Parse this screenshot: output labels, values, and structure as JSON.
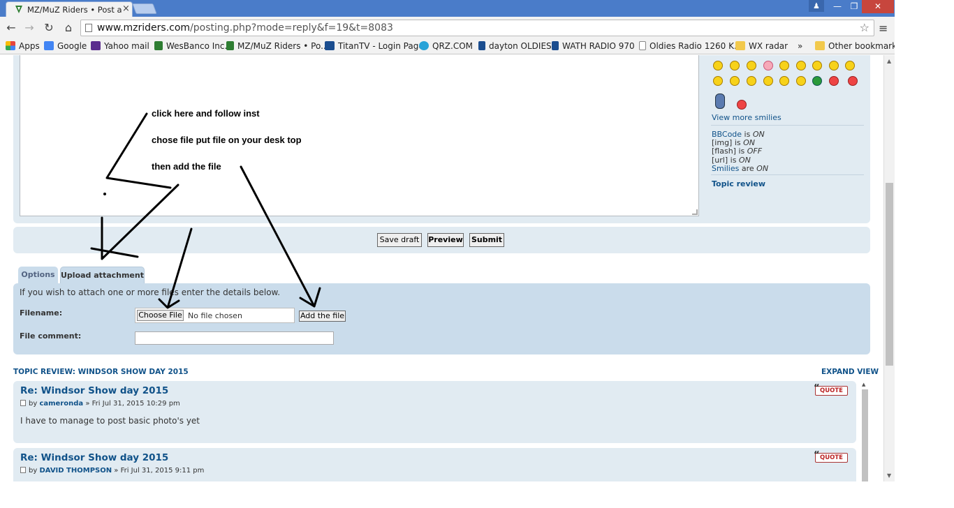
{
  "browser": {
    "tab_title": "MZ/MuZ Riders • Post a re",
    "tab_close": "×",
    "window_controls": {
      "user": "♟",
      "minimize": "—",
      "maximize": "❐",
      "close": "✕"
    },
    "nav": {
      "back": "←",
      "forward": "→",
      "reload": "↻",
      "home": "⌂"
    },
    "url_host": "www.mzriders.com",
    "url_path": "/posting.php?mode=reply&f=19&t=8083",
    "star": "☆",
    "menu": "≡"
  },
  "bookmarks": {
    "items": [
      {
        "label": "Apps",
        "icon": "apps-icon",
        "color": "#e8453c"
      },
      {
        "label": "Google",
        "icon": "google-icon",
        "color": "#4285f4"
      },
      {
        "label": "Yahoo mail",
        "icon": "yahoo-icon",
        "color": "#5b2d8e"
      },
      {
        "label": "WesBanco Inc.",
        "icon": "wesbanco-icon",
        "color": "#2e7d32"
      },
      {
        "label": "MZ/MuZ Riders • Po...",
        "icon": "mz-icon",
        "color": "#2e7d32"
      },
      {
        "label": "TitanTV - Login Page",
        "icon": "titantv-icon",
        "color": "#1a4d8f"
      },
      {
        "label": "QRZ.COM",
        "icon": "globe-icon",
        "color": "#29a3d8"
      },
      {
        "label": "dayton OLDIES",
        "icon": "speaker-icon",
        "color": "#1a4d8f"
      },
      {
        "label": "WATH RADIO 970",
        "icon": "speaker-icon",
        "color": "#1a4d8f"
      },
      {
        "label": "Oldies Radio 1260 K...",
        "icon": "page-icon",
        "color": "#ffffff"
      },
      {
        "label": "WX radar",
        "icon": "folder-icon",
        "color": "#f2c94c"
      }
    ],
    "overflow": "»",
    "other": "Other bookmarks"
  },
  "sidebar": {
    "view_more_smilies": "View more smilies",
    "bbcode": {
      "label": "BBCode",
      "is": " is ",
      "state": "ON"
    },
    "img": {
      "label": "[img]",
      "is": " is ",
      "state": "ON"
    },
    "flash": {
      "label": "[flash]",
      "is": " is ",
      "state": "OFF"
    },
    "url": {
      "label": "[url]",
      "is": " is ",
      "state": "ON"
    },
    "smilies": {
      "label": "Smilies",
      "is": " are ",
      "state": "ON"
    },
    "topic_review": "Topic review"
  },
  "buttons": {
    "save_draft": "Save draft",
    "preview": "Preview",
    "submit": "Submit"
  },
  "tabs": {
    "options": "Options",
    "upload": "Upload attachment"
  },
  "upload": {
    "intro": "If you wish to attach one or more files enter the details below.",
    "filename_label": "Filename:",
    "choose_file": "Choose File",
    "no_file": "No file chosen",
    "add_file": "Add the file",
    "comment_label": "File comment:"
  },
  "topic_review": {
    "heading": "TOPIC REVIEW: WINDSOR SHOW DAY 2015",
    "expand": "EXPAND VIEW",
    "quote_label": "QUOTE",
    "posts": [
      {
        "title": "Re: Windsor Show day 2015",
        "by": "by ",
        "author": "cameronda",
        "date": " » Fri Jul 31, 2015 10:29 pm",
        "body": "I have to manage to post basic photo's yet"
      },
      {
        "title": "Re: Windsor Show day 2015",
        "by": "by ",
        "author": "DAVID THOMPSON",
        "date": " » Fri Jul 31, 2015 9:11 pm",
        "body": ""
      }
    ]
  },
  "annotations": {
    "line1": "click here and follow inst",
    "line2": "chose file put file on your desk top",
    "line3": "then add the file"
  }
}
